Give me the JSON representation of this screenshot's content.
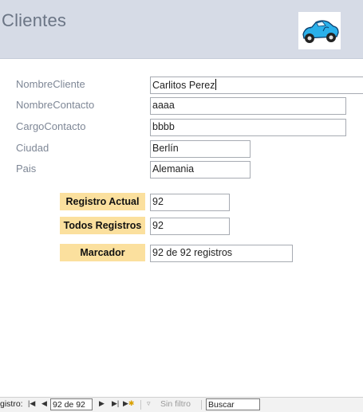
{
  "header": {
    "title": "Clientes"
  },
  "fields": [
    {
      "label": "NombreCliente",
      "value": "Carlitos Perez"
    },
    {
      "label": "NombreContacto",
      "value": "aaaa"
    },
    {
      "label": "CargoContacto",
      "value": "bbbb"
    },
    {
      "label": "Ciudad",
      "value": "Berlín"
    },
    {
      "label": "Pais",
      "value": "Alemania"
    }
  ],
  "stats": {
    "registro_actual_label": "Registro Actual",
    "registro_actual_value": "92",
    "todos_registros_label": "Todos Registros",
    "todos_registros_value": "92",
    "marcador_label": "Marcador",
    "marcador_value": "92 de 92 registros"
  },
  "navbar": {
    "label": "gistro:",
    "first_icon": "first-record-icon",
    "prev_icon": "previous-record-icon",
    "position": "92 de 92",
    "next_icon": "next-record-icon",
    "last_icon": "last-record-icon",
    "new_icon": "new-record-icon",
    "filter_icon": "filter-icon",
    "filter_label": "Sin filtro",
    "search_value": "Buscar"
  },
  "colors": {
    "header_bg": "#d6dbe6",
    "label_box_bg": "#fbe09e"
  }
}
